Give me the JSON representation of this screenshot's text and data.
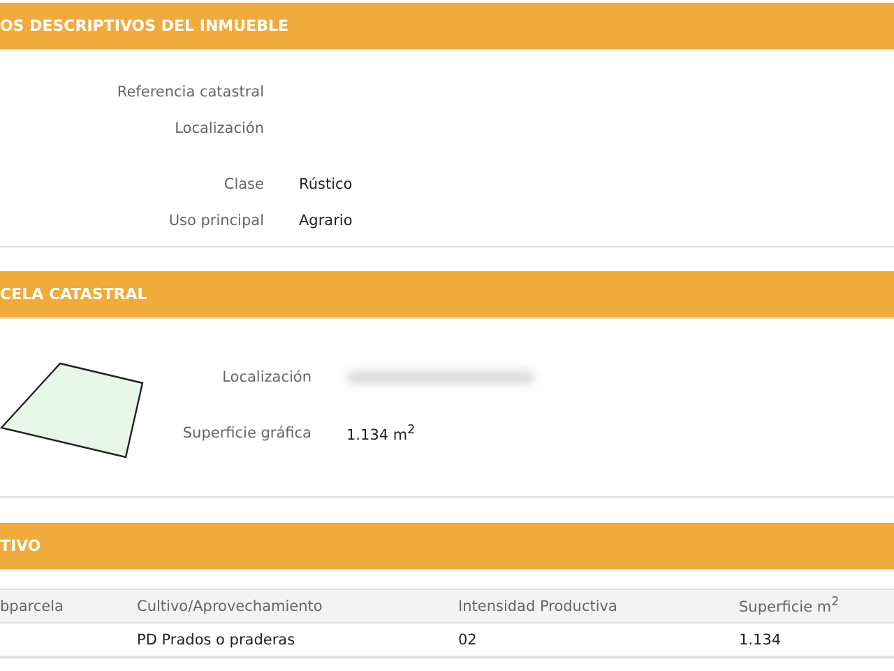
{
  "sections": [
    {
      "title": "OS DESCRIPTIVOS DEL INMUEBLE",
      "kind": "fields",
      "groups": [
        [
          {
            "label": "Referencia catastral"
          },
          {
            "label": "Localización"
          }
        ],
        [
          {
            "label": "Clase",
            "value": "Rústico"
          },
          {
            "label": "Uso principal",
            "value": "Agrario"
          }
        ]
      ]
    },
    {
      "title": "CELA CATASTRAL",
      "kind": "parcel",
      "fields": [
        {
          "label": "Localización",
          "redacted": true
        },
        {
          "label": "Superficie gráfica",
          "value": "1.134 m$^{2}$"
        }
      ]
    },
    {
      "title": "TIVO",
      "kind": "table",
      "columns": [
        "bparcela",
        "Cultivo/Aprovechamiento",
        "Intensidad Productiva",
        "Superficie m$^{2}$"
      ],
      "rows": [
        [
          "",
          "PD Prados o praderas",
          "02",
          "1.134"
        ]
      ]
    }
  ]
}
